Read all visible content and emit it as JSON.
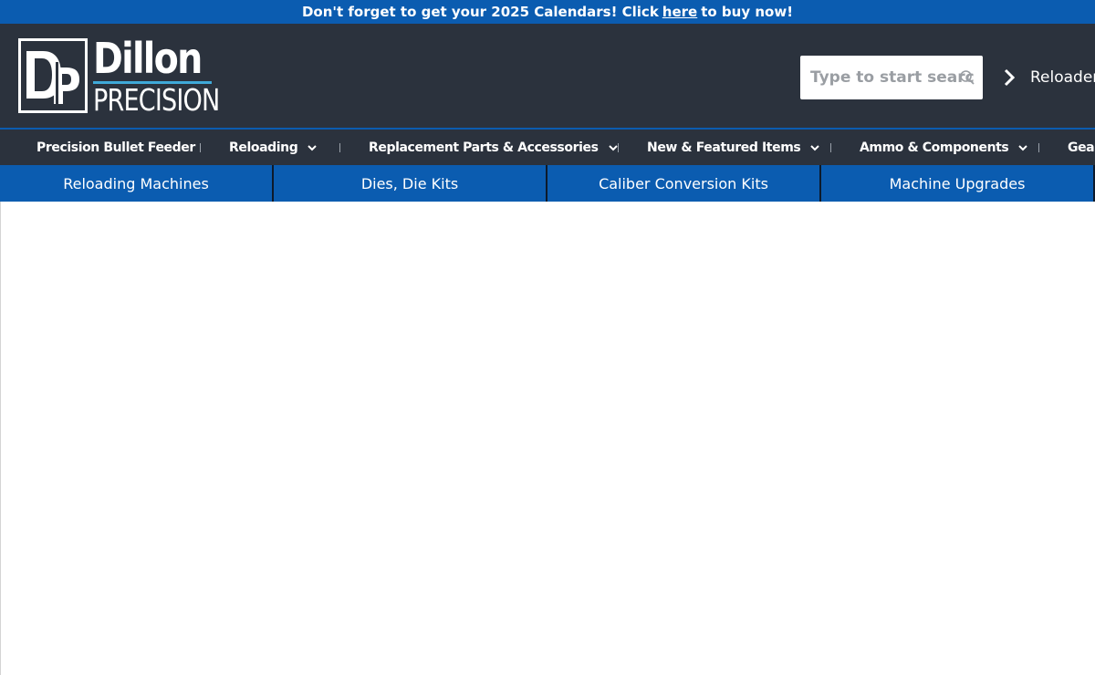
{
  "announcement": {
    "prefix": "Don't forget to get your 2025 Calendars! Click",
    "link": "here",
    "suffix": "to buy now!"
  },
  "logo": {
    "line1": "Dillon",
    "line2": "PRECISION",
    "monogram": "DP"
  },
  "search": {
    "placeholder": "Type to start searching",
    "icon": "search-icon"
  },
  "header_link": {
    "label": "Reloader.c",
    "icon": "chevron-right-icon"
  },
  "main_nav": [
    {
      "label": "Precision Bullet Feeder",
      "has_dropdown": false
    },
    {
      "label": "Reloading",
      "has_dropdown": true
    },
    {
      "label": "Replacement Parts & Accessories",
      "has_dropdown": true
    },
    {
      "label": "New & Featured Items",
      "has_dropdown": true
    },
    {
      "label": "Ammo & Components",
      "has_dropdown": true
    },
    {
      "label": "Gear",
      "has_dropdown": false
    }
  ],
  "sub_nav": [
    {
      "label": "Reloading Machines"
    },
    {
      "label": "Dies, Die Kits"
    },
    {
      "label": "Caliber Conversion Kits"
    },
    {
      "label": "Machine Upgrades"
    }
  ],
  "colors": {
    "brand_blue": "#0b5cb0",
    "header_dark": "#2b323d",
    "logo_accent": "#3fa9d8"
  }
}
